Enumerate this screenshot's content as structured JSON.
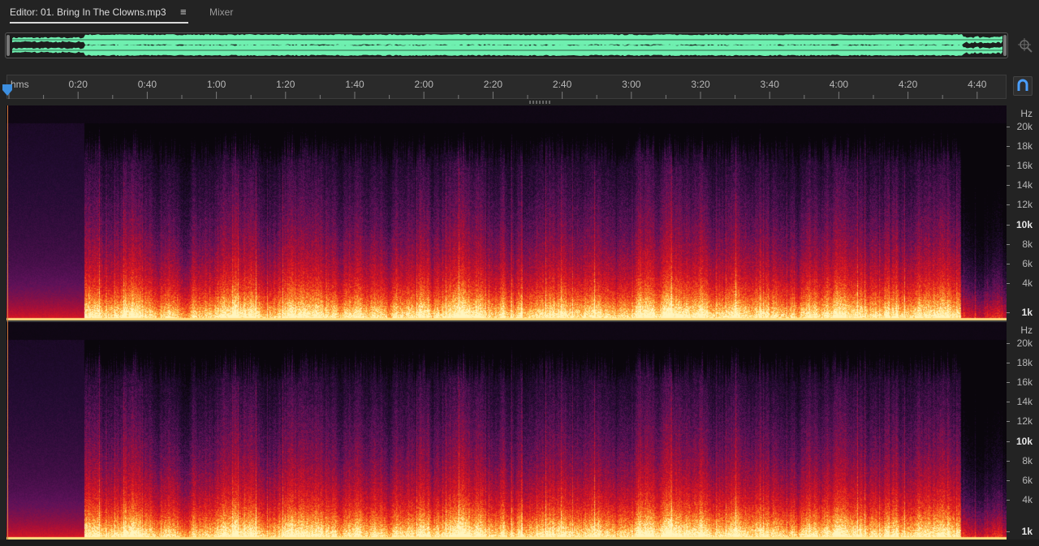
{
  "tabs": {
    "editor_label": "Editor: 01. Bring In The Clowns.mp3",
    "mixer_label": "Mixer"
  },
  "icons": {
    "panel_menu": "menu-icon",
    "zoom_navigator": "zoom-icon",
    "snap_toggle": "magnet-icon",
    "playhead": "playhead-marker-icon"
  },
  "ruler": {
    "unit_label": "hms",
    "labels": [
      "0:20",
      "0:40",
      "1:00",
      "1:20",
      "1:40",
      "2:00",
      "2:20",
      "2:40",
      "3:00",
      "3:20",
      "3:40",
      "4:00",
      "4:20",
      "4:40"
    ],
    "major_interval_s": 20,
    "minor_per_major": 2
  },
  "frequency_axis": {
    "unit": "Hz",
    "labels": [
      "20k",
      "18k",
      "16k",
      "14k",
      "12k",
      "10k",
      "8k",
      "6k",
      "4k",
      "1k"
    ],
    "emphasized": [
      "10k",
      "1k"
    ]
  },
  "colors": {
    "background": "#232323",
    "waveform": "#6ff0b0",
    "spectrogram_low": "#160a22",
    "spectrogram_mid": "#c8102e",
    "spectrogram_high": "#ffe08a",
    "playhead": "#3d8fe0",
    "cursor": "#d07a3a"
  }
}
